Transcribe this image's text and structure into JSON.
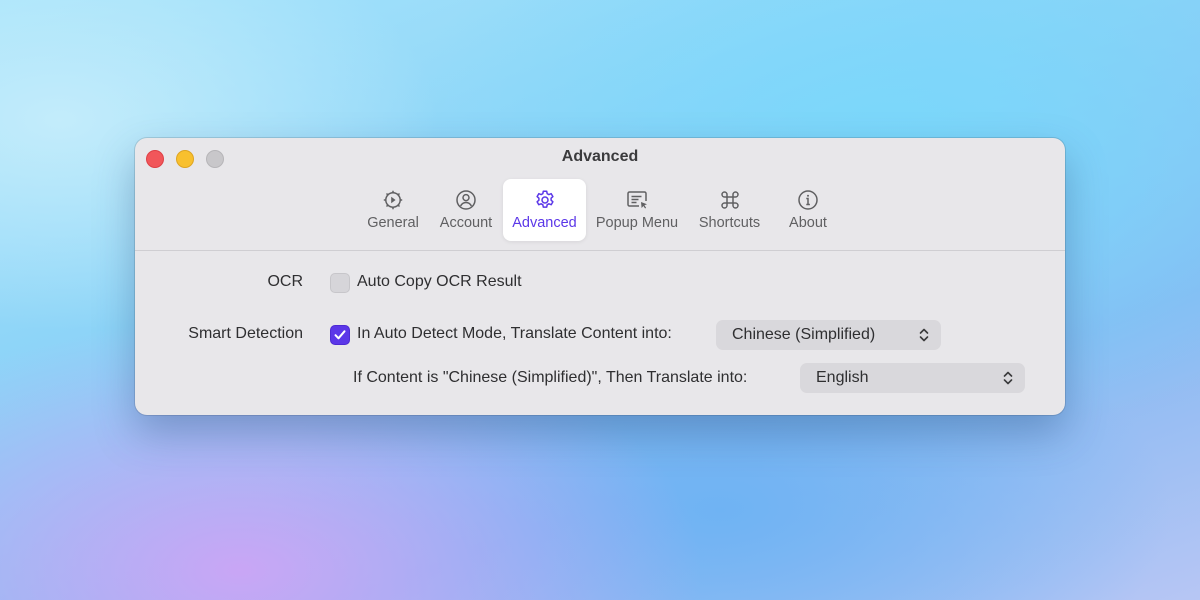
{
  "window": {
    "title": "Advanced"
  },
  "tabs": [
    {
      "label": "General",
      "icon": "gear-play-icon"
    },
    {
      "label": "Account",
      "icon": "person-circle-icon"
    },
    {
      "label": "Advanced",
      "icon": "gear-icon",
      "active": true
    },
    {
      "label": "Popup Menu",
      "icon": "text-cursor-window-icon"
    },
    {
      "label": "Shortcuts",
      "icon": "command-icon"
    },
    {
      "label": "About",
      "icon": "info-circle-icon"
    }
  ],
  "ocr": {
    "label": "OCR",
    "checkbox_label": "Auto Copy OCR Result",
    "checked": false
  },
  "smart_detection": {
    "label": "Smart Detection",
    "checkbox_label": "In Auto Detect Mode, Translate Content into:",
    "checked": true,
    "target_language": "Chinese (Simplified)",
    "fallback_label": "If Content is \"Chinese (Simplified)\", Then Translate into:",
    "fallback_language": "English"
  },
  "colors": {
    "accent": "#5b37e8",
    "close": "#f1565a",
    "minimize": "#f8c02e",
    "zoom": "#c8c7ca"
  }
}
